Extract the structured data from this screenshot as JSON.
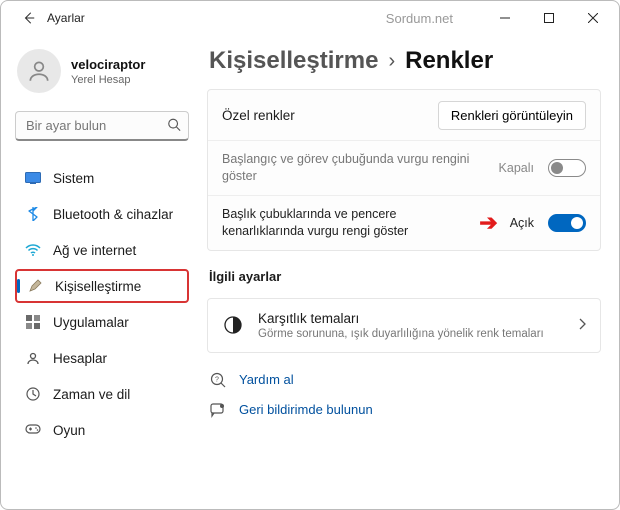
{
  "window": {
    "app_title": "Ayarlar",
    "watermark": "Sordum.net"
  },
  "user": {
    "name": "velociraptor",
    "account_type": "Yerel Hesap"
  },
  "search": {
    "placeholder": "Bir ayar bulun"
  },
  "nav": {
    "items": [
      {
        "label": "Sistem"
      },
      {
        "label": "Bluetooth & cihazlar"
      },
      {
        "label": "Ağ ve internet"
      },
      {
        "label": "Kişiselleştirme"
      },
      {
        "label": "Uygulamalar"
      },
      {
        "label": "Hesaplar"
      },
      {
        "label": "Zaman ve dil"
      },
      {
        "label": "Oyun"
      }
    ]
  },
  "breadcrumb": {
    "root": "Kişiselleştirme",
    "leaf": "Renkler"
  },
  "cards": {
    "custom_colors": {
      "title": "Özel renkler",
      "button": "Renkleri görüntüleyin"
    },
    "accent_taskbar": {
      "text": "Başlangıç ve görev çubuğunda vurgu rengini göster",
      "state": "Kapalı"
    },
    "accent_title": {
      "text": "Başlık çubuklarında ve pencere kenarlıklarında vurgu rengi göster",
      "state": "Açık"
    }
  },
  "related": {
    "heading": "İlgili ayarlar",
    "contrast": {
      "title": "Karşıtlık temaları",
      "sub": "Görme sorununa, ışık duyarlılığına yönelik renk temaları"
    }
  },
  "footer": {
    "help": "Yardım al",
    "feedback": "Geri bildirimde bulunun"
  }
}
